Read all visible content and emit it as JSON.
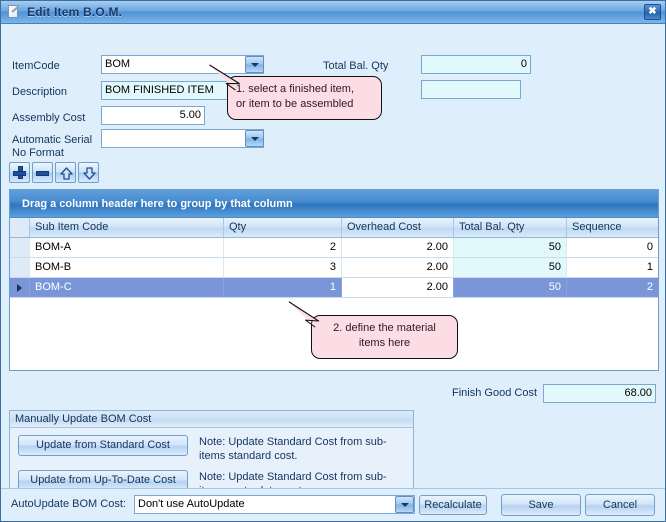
{
  "window": {
    "title": "Edit Item B.O.M.",
    "close_label": "✖",
    "icon": "edit-document-icon"
  },
  "form": {
    "itemcode_label": "ItemCode",
    "itemcode_value": "BOM",
    "description_label": "Description",
    "description_value": "BOM FINISHED ITEM",
    "assembly_cost_label": "Assembly Cost",
    "assembly_cost_value": "5.00",
    "serial_label": "Automatic Serial\nNo Format",
    "serial_value": "",
    "total_bal_qty_label": "Total Bal. Qty",
    "total_bal_qty_value": "0",
    "second_readonly_value": ""
  },
  "toolbar": {
    "add_label": "add-row",
    "remove_label": "remove-row",
    "move_up_label": "move-row-up",
    "move_down_label": "move-row-down"
  },
  "grid": {
    "group_bar_text": "Drag a column header here to group by that column",
    "columns": [
      "Sub Item Code",
      "Qty",
      "Overhead Cost",
      "Total Bal. Qty",
      "Sequence"
    ],
    "rows": [
      {
        "code": "BOM-A",
        "qty": "2",
        "overhead": "2.00",
        "total_bal_qty": "50",
        "sequence": "0",
        "selected": false
      },
      {
        "code": "BOM-B",
        "qty": "3",
        "overhead": "2.00",
        "total_bal_qty": "50",
        "sequence": "1",
        "selected": false
      },
      {
        "code": "BOM-C",
        "qty": "1",
        "overhead": "2.00",
        "total_bal_qty": "50",
        "sequence": "2",
        "selected": true
      }
    ]
  },
  "callouts": {
    "one": "1. select a finished item,\nor item to be assembled",
    "two": "2. define the material\nitems here"
  },
  "finish_good": {
    "label": "Finish Good Cost",
    "value": "68.00"
  },
  "groupbox": {
    "title": "Manually Update BOM Cost",
    "button_standard": "Update from Standard Cost",
    "note_standard": "Note: Update Standard Cost from sub-items standard cost.",
    "button_uptodate": "Update from Up-To-Date Cost",
    "note_uptodate": "Note: Update Standard Cost from sub-items up-to-date cost."
  },
  "footer": {
    "autoupdate_label": "AutoUpdate BOM Cost:",
    "autoupdate_value": "Don't use AutoUpdate",
    "recalculate_label": "Recalculate",
    "save_label": "Save",
    "cancel_label": "Cancel"
  },
  "colors": {
    "titlebar_accent": "#4f92d8",
    "readonly_field": "#e2f9fb",
    "selection": "#7b96d8",
    "callout_bg": "#fcdde6",
    "dialog_bg": "#dfeefb"
  }
}
